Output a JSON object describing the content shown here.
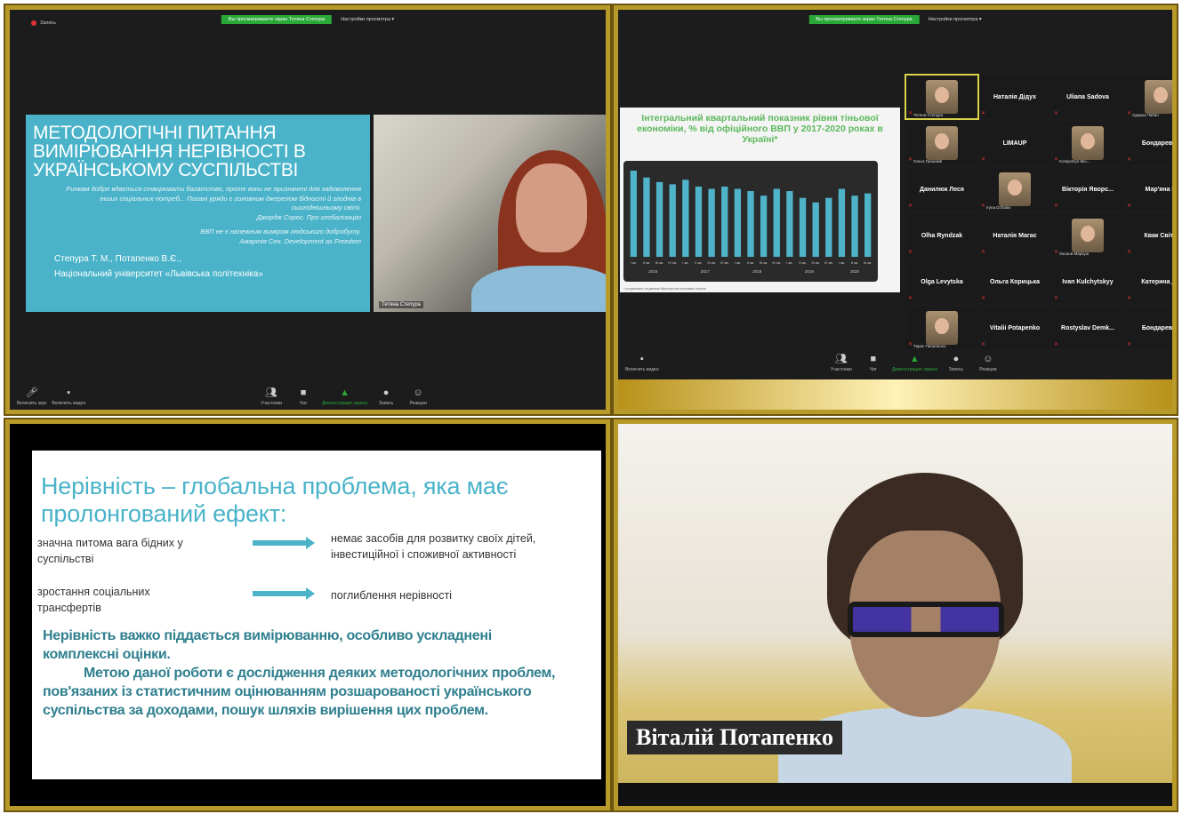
{
  "zoom": {
    "banner_green": "Вы просматриваете экран Тетяна Степура",
    "banner_view": "Настройки просмотра ▾",
    "record": "Запись"
  },
  "q1": {
    "slide_title": "МЕТОДОЛОГІЧНІ ПИТАННЯ ВИМІРЮВАННЯ НЕРІВНОСТІ В УКРАЇНСЬКОМУ СУСПІЛЬСТВІ",
    "quote1": "Ринкам добре вдається створювати багатство, проте вони не призначені для задоволення інших соціальних потреб... Погані уряди є головним джерелом бідності й злиднів в сьогоднішньому світі.",
    "quote1_author": "Джордж Сорос. Про глобалізацію",
    "quote2": "ВВП не є належним виміром людського добробуту.",
    "quote2_author": "Амартія Сен. Development as Freedom",
    "authors": "Степура Т. М., Потапенко В.Є.,",
    "university": "Національний університет «Львівська політехніка»",
    "speaker_name": "Тетяна Степура",
    "toolbar": {
      "unmute": "Включить звук",
      "video": "Включить видео",
      "participants": "Участники",
      "participants_count": "24",
      "chat": "Чат",
      "share": "Демонстрация экрана",
      "record": "Запись",
      "reactions": "Реакции"
    }
  },
  "q2": {
    "slide_title": "Інтегральний квартальний показник рівня тіньової економіки, % від офіційного ВВП у 2017-2020 роках в Україні*",
    "years": [
      "2016",
      "2017",
      "2018",
      "2019",
      "2020"
    ],
    "note": "* розраховано за даними Міністерства економіки України",
    "participants": [
      {
        "name": "Тетяна Степура",
        "type": "video"
      },
      {
        "name": "Наталія Дідух",
        "type": "text"
      },
      {
        "name": "Uliana Sadova",
        "type": "text"
      },
      {
        "name": "Одарка Чабан",
        "type": "video"
      },
      {
        "name": "Ольга Грешний",
        "type": "video"
      },
      {
        "name": "LIMAUP",
        "type": "text"
      },
      {
        "name": "Kostyantyn Mio...",
        "type": "video"
      },
      {
        "name": "Бондаревсь",
        "type": "text"
      },
      {
        "name": "Данилюк Леся",
        "type": "text"
      },
      {
        "name": "Iryna Dzhalav",
        "type": "video"
      },
      {
        "name": "Вікторія Яворс...",
        "type": "text"
      },
      {
        "name": "Мар'яна Б",
        "type": "text"
      },
      {
        "name": "Olha Ryndzak",
        "type": "text"
      },
      {
        "name": "Наталія Магас",
        "type": "text"
      },
      {
        "name": "Оксана Маркуш",
        "type": "video"
      },
      {
        "name": "Квак Світл",
        "type": "text"
      },
      {
        "name": "Olga Levytska",
        "type": "text"
      },
      {
        "name": "Ольга Корицька",
        "type": "text"
      },
      {
        "name": "Ivan Kulchytskyy",
        "type": "text"
      },
      {
        "name": "Катерина Др",
        "type": "text"
      },
      {
        "name": "Тарас Пилипенко",
        "type": "video"
      },
      {
        "name": "Vitalii Potapenko",
        "type": "text"
      },
      {
        "name": "Rostyslav Demk...",
        "type": "text"
      },
      {
        "name": "Бондаревсь",
        "type": "text"
      }
    ],
    "toolbar": {
      "video": "Включить видео",
      "participants": "Участники",
      "participants_count": "24",
      "chat": "Чат",
      "share": "Демонстрация экрана",
      "record": "Запись",
      "reactions": "Реакции"
    }
  },
  "chart_data": {
    "type": "bar",
    "title": "Інтегральний квартальний показник рівня тіньової економіки, % від офіційного ВВП у 2017-2020 роках в Україні*",
    "categories": [
      "I кв.",
      "II кв.",
      "III кв.",
      "IV кв.",
      "I кв.",
      "II кв.",
      "III кв.",
      "IV кв.",
      "I кв.",
      "II кв.",
      "III кв.",
      "IV кв.",
      "I кв.",
      "II кв.",
      "III кв.",
      "IV кв.",
      "I кв.",
      "II кв.",
      "III кв."
    ],
    "x_groups": [
      "2016",
      "2017",
      "2018",
      "2019",
      "2020"
    ],
    "values": [
      38,
      35,
      33,
      32,
      34,
      31,
      30,
      31,
      30,
      29,
      27,
      30,
      29,
      26,
      24,
      26,
      30,
      27,
      28
    ],
    "ylim": [
      0,
      40
    ],
    "colors": {
      "bar": "#4fb3c9",
      "background": "#2a2a2a"
    }
  },
  "q3": {
    "title": "Нерівність – глобальна проблема, яка має пролонгований ефект:",
    "left1": "значна питома вага бідних у суспільстві",
    "right1": "немає засобів для розвитку своїх дітей, інвестиційної і споживчої активності",
    "left2": "зростання соціальних трансфертів",
    "right2": "поглиблення нерівності",
    "bold1": "Нерівність важко піддається вимірюванню, особливо ускладнені комплексні оцінки.",
    "bold2": "Метою даної роботи є дослідження деяких методологічних проблем, пов'язаних із статистичним оцінюванням розшарованості українського суспільства за доходами, пошук шляхів вирішення цих проблем."
  },
  "q4": {
    "name": "Віталій Потапенко"
  },
  "colors": {
    "frame": "#b89a2a",
    "zoom_green": "#2aa838",
    "slide_teal": "#4ab3c9",
    "slide_dark_teal": "#2f7f8e"
  }
}
